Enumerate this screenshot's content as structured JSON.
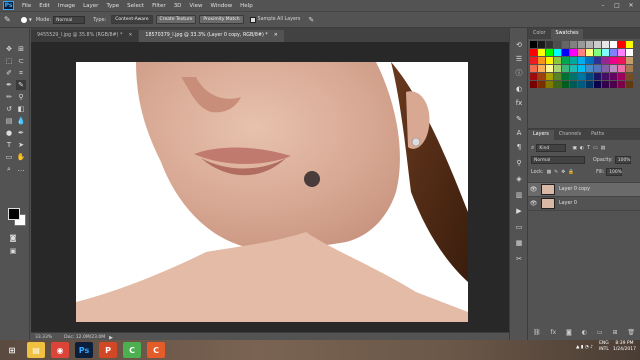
{
  "app": {
    "logo": "Ps",
    "menu": [
      "File",
      "Edit",
      "Image",
      "Layer",
      "Type",
      "Select",
      "Filter",
      "3D",
      "View",
      "Window",
      "Help"
    ],
    "window_controls": [
      "–",
      "□",
      "✕"
    ]
  },
  "options_bar": {
    "mode_label": "Mode:",
    "mode_value": "Normal",
    "type_label": "Type:",
    "type_buttons": [
      "Content-Aware",
      "Create Texture",
      "Proximity Match"
    ],
    "sample_all_layers": "Sample All Layers"
  },
  "tabs": [
    {
      "label": "9455529_l.jpg @ 35.8% (RGB/8#) *",
      "active": false
    },
    {
      "label": "18570379_l.jpg @ 33.3% (Layer 0 copy, RGB/8#) *",
      "active": true
    }
  ],
  "status": {
    "zoom": "33.33%",
    "doc": "Doc: 12.0M/23.0M"
  },
  "swatches_panel": {
    "tabs": [
      "Color",
      "Swatches"
    ],
    "active": "Swatches",
    "colors": [
      "#000000",
      "#1a1a1a",
      "#333333",
      "#4d4d4d",
      "#666666",
      "#808080",
      "#999999",
      "#b3b3b3",
      "#cccccc",
      "#e6e6e6",
      "#ffffff",
      "#ff0000",
      "#ffff00",
      "#ff0000",
      "#ffff00",
      "#00ff00",
      "#00ffff",
      "#0000ff",
      "#ff00ff",
      "#ff8080",
      "#ffff80",
      "#80ff80",
      "#80ffff",
      "#8080ff",
      "#ff80ff",
      "#ffffff",
      "#ed1c24",
      "#f7941d",
      "#fff200",
      "#8dc63f",
      "#00a651",
      "#00a99d",
      "#00aeef",
      "#0072bc",
      "#2e3192",
      "#92278f",
      "#ec008c",
      "#ed145b",
      "#c69c6d",
      "#f26c4f",
      "#fbaf5d",
      "#fff799",
      "#acd373",
      "#3cb878",
      "#1cbbb4",
      "#00bff3",
      "#448ccb",
      "#5674b9",
      "#855fa8",
      "#bc8dbf",
      "#f06eaa",
      "#a67c52",
      "#9e0b0f",
      "#a0410d",
      "#aba000",
      "#598527",
      "#007236",
      "#00746b",
      "#0076a3",
      "#004a80",
      "#1b1464",
      "#440e62",
      "#630460",
      "#9e005d",
      "#754c24",
      "#790000",
      "#7b2e00",
      "#827b00",
      "#406618",
      "#005e20",
      "#005952",
      "#005b7f",
      "#003663",
      "#0d004c",
      "#32004b",
      "#4b0049",
      "#7b0046",
      "#603913"
    ]
  },
  "layers_panel": {
    "tabs": [
      "Layers",
      "Channels",
      "Paths"
    ],
    "active": "Layers",
    "filter_kind": "Kind",
    "blend_mode": "Normal",
    "opacity_label": "Opacity:",
    "opacity_value": "100%",
    "lock_label": "Lock:",
    "fill_label": "Fill:",
    "fill_value": "100%",
    "layers": [
      {
        "name": "Layer 0 copy",
        "selected": true
      },
      {
        "name": "Layer 0",
        "selected": false
      }
    ]
  },
  "taskbar": {
    "apps": [
      {
        "icon": "file-explorer-icon",
        "color": "#f0c040",
        "glyph": "▤"
      },
      {
        "icon": "chrome-icon",
        "color": "#db4437",
        "glyph": "◉"
      },
      {
        "icon": "photoshop-icon",
        "color": "#0c1f3a",
        "glyph": "Ps"
      },
      {
        "icon": "powerpoint-icon",
        "color": "#d24726",
        "glyph": "P"
      },
      {
        "icon": "camtasia-icon",
        "color": "#4caf50",
        "glyph": "C"
      },
      {
        "icon": "camtasia-recorder-icon",
        "color": "#e55c2b",
        "glyph": "C"
      }
    ],
    "lang": "ENG",
    "locale": "INTL",
    "time": "8:39 PM",
    "date": "1/24/2017"
  }
}
